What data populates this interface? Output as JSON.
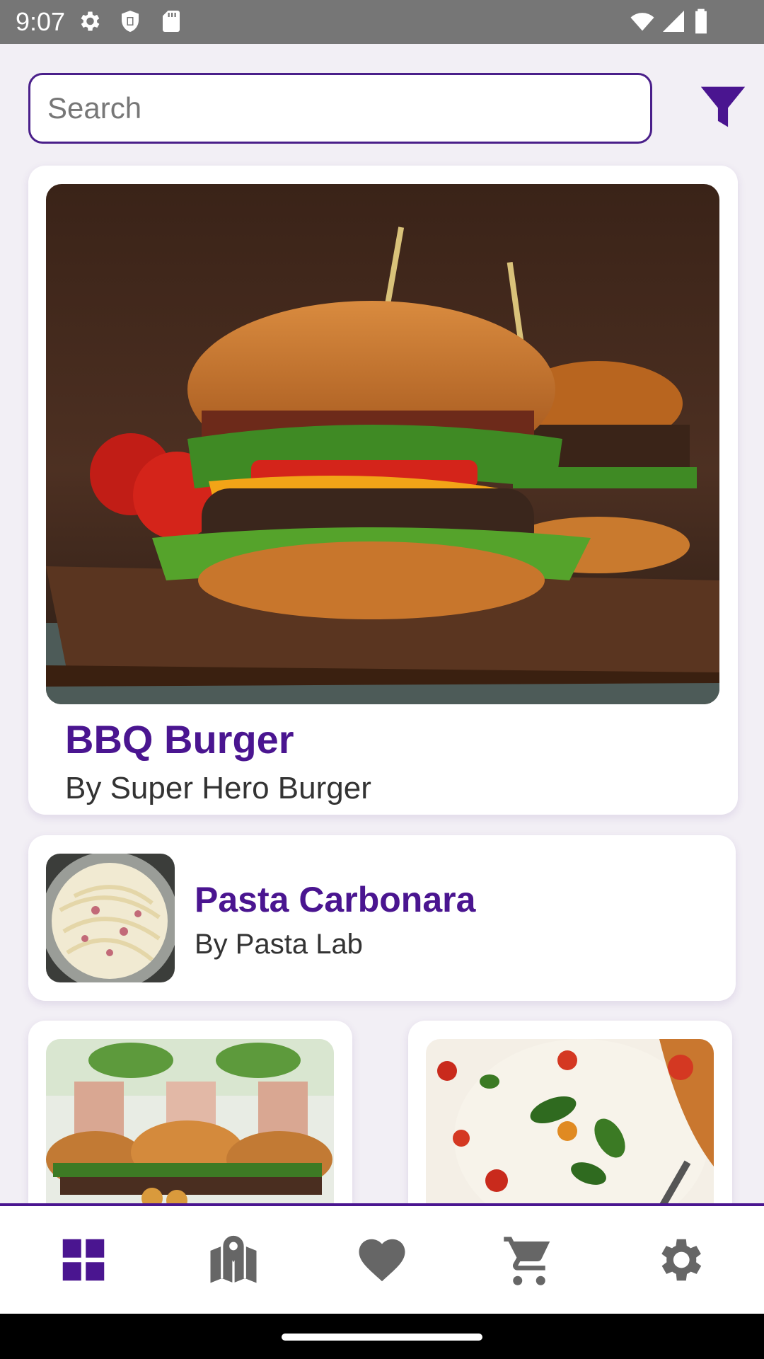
{
  "status_bar": {
    "time": "9:07",
    "icons_left": [
      "settings-icon",
      "shield-icon",
      "sd-card-icon"
    ],
    "icons_right": [
      "wifi-icon",
      "signal-icon",
      "battery-icon"
    ]
  },
  "search": {
    "placeholder": "Search",
    "value": ""
  },
  "filter": {
    "icon": "filter-icon"
  },
  "featured": {
    "title": "BBQ Burger",
    "subtitle": "By Super Hero Burger"
  },
  "list_item": {
    "title": "Pasta Carbonara",
    "subtitle": "By Pasta Lab"
  },
  "grid_items": [
    {
      "image": "burger-platter-image"
    },
    {
      "image": "pizza-image"
    }
  ],
  "bottom_nav": {
    "items": [
      {
        "icon": "dashboard-icon",
        "active": true
      },
      {
        "icon": "map-icon",
        "active": false
      },
      {
        "icon": "heart-icon",
        "active": false
      },
      {
        "icon": "cart-icon",
        "active": false
      },
      {
        "icon": "settings-icon",
        "active": false
      }
    ]
  },
  "colors": {
    "accent": "#4a1590",
    "inactive_icon": "#666666",
    "status_bar": "#767676",
    "background": "#f2eff5"
  }
}
